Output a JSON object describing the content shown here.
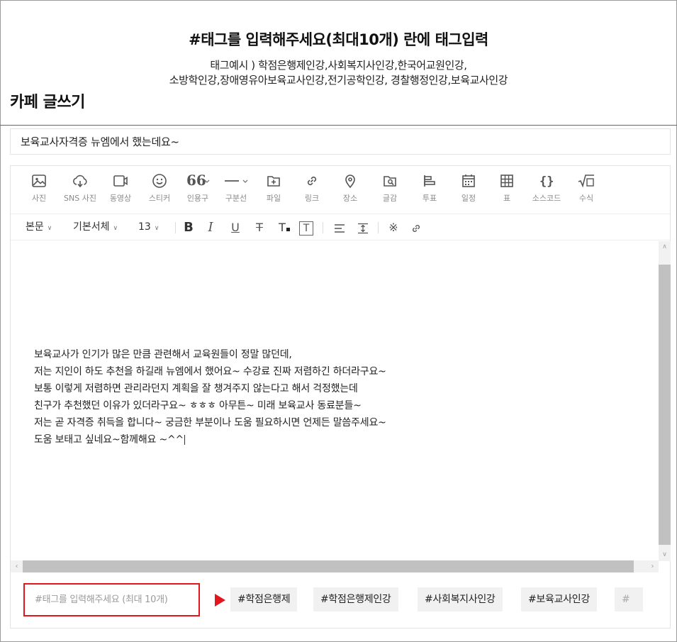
{
  "instruction": {
    "title": "#태그를 입력해주세요(최대10개) 란에 태그입력",
    "example_line1": "태그예시 ) 학점은행제인강,사회복지사인강,한국어교원인강,",
    "example_line2": "소방학인강,장애영유아보육교사인강,전기공학인강, 경찰행정인강,보육교사인강"
  },
  "page": {
    "title": "카페 글쓰기"
  },
  "subject": {
    "value": "보육교사자격증 뉴엠에서 했는데요~"
  },
  "toolbar": {
    "items": [
      {
        "icon": "photo-icon",
        "label": "사진"
      },
      {
        "icon": "sns-photo-icon",
        "label": "SNS 사진"
      },
      {
        "icon": "video-icon",
        "label": "동영상"
      },
      {
        "icon": "sticker-icon",
        "label": "스티커"
      },
      {
        "icon": "quote-icon",
        "label": "인용구"
      },
      {
        "icon": "divider-icon",
        "label": "구분선"
      },
      {
        "icon": "file-icon",
        "label": "파일"
      },
      {
        "icon": "link-icon",
        "label": "링크"
      },
      {
        "icon": "place-icon",
        "label": "장소"
      },
      {
        "icon": "material-icon",
        "label": "글감"
      },
      {
        "icon": "vote-icon",
        "label": "투표"
      },
      {
        "icon": "calendar-icon",
        "label": "일정"
      },
      {
        "icon": "table-icon",
        "label": "표"
      },
      {
        "icon": "source-code-icon",
        "label": "소스코드"
      },
      {
        "icon": "formula-icon",
        "label": "수식"
      }
    ]
  },
  "format_bar": {
    "paragraph": "본문",
    "font": "기본서체",
    "size": "13",
    "icons": [
      "bold-icon",
      "italic-icon",
      "underline-icon",
      "strikethrough-icon",
      "font-color-icon",
      "highlight-icon",
      "align-icon",
      "line-spacing-icon",
      "special-char-icon",
      "link-icon"
    ],
    "glyphs": {
      "bold": "B",
      "italic": "I",
      "underline": "U",
      "strike": "T",
      "color": "T",
      "highlight": "T",
      "special": "※"
    }
  },
  "content": {
    "lines": [
      "보육교사가 인기가 많은 만큼 관련해서 교육원들이 정말 많던데,",
      "저는 지인이 하도 추천을 하길래 뉴엠에서 했어요~ 수강료 진짜 저렴하긴 하더라구요~",
      "보통 이렇게 저렴하면 관리라던지 계획을 잘 챙겨주지 않는다고 해서 걱정했는데",
      "친구가 추천했던 이유가 있더라구요~ ㅎㅎㅎ 아무튼~ 미래 보육교사 동료분들~",
      "저는 곧 자격증 취득을 합니다~ 궁금한 부분이나 도움 필요하시면 언제든 말씀주세요~",
      "도움 보태고 싶네요~함께해요 ~^^"
    ]
  },
  "tags": {
    "placeholder": "#태그를 입력해주세요 (최대 10개)",
    "chips": [
      "#학점은행제",
      "#학점은행제인강",
      "#사회복지사인강",
      "#보육교사인강",
      "#"
    ]
  },
  "colors": {
    "highlight": "#e3161e",
    "chip_bg": "#f1f1f1"
  }
}
